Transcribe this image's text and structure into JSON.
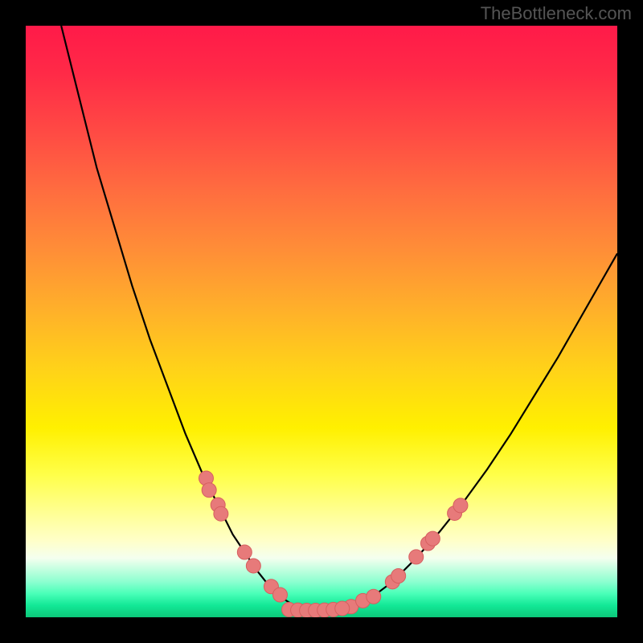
{
  "attribution": "TheBottleneck.com",
  "chart_data": {
    "type": "line",
    "title": "",
    "xlabel": "",
    "ylabel": "",
    "xlim": [
      0,
      100
    ],
    "ylim": [
      0,
      100
    ],
    "curve": {
      "name": "bottleneck-curve",
      "x": [
        6,
        9,
        12,
        15,
        18,
        21,
        24,
        27,
        30,
        33,
        35,
        37,
        39,
        41,
        43,
        45,
        47,
        49,
        51,
        54,
        58,
        62,
        66,
        70,
        74,
        78,
        82,
        86,
        90,
        94,
        98,
        100
      ],
      "y": [
        100,
        88,
        76,
        66,
        56,
        47,
        39,
        31,
        24,
        18,
        14,
        11,
        8,
        5.5,
        3.5,
        2.2,
        1.4,
        1.0,
        1.0,
        1.4,
        3.0,
        6.0,
        10.0,
        14.5,
        19.5,
        25.0,
        31.0,
        37.5,
        44.0,
        51.0,
        58.0,
        61.5
      ]
    },
    "markers": {
      "left_cluster": [
        {
          "x": 30.5,
          "y": 23.5
        },
        {
          "x": 31.0,
          "y": 21.5
        },
        {
          "x": 32.5,
          "y": 19.0
        },
        {
          "x": 33.0,
          "y": 17.5
        },
        {
          "x": 37.0,
          "y": 11.0
        },
        {
          "x": 38.5,
          "y": 8.7
        },
        {
          "x": 41.5,
          "y": 5.2
        },
        {
          "x": 43.0,
          "y": 3.8
        }
      ],
      "right_cluster": [
        {
          "x": 55.0,
          "y": 1.8
        },
        {
          "x": 57.0,
          "y": 2.8
        },
        {
          "x": 58.8,
          "y": 3.5
        },
        {
          "x": 62.0,
          "y": 6.0
        },
        {
          "x": 63.0,
          "y": 7.0
        },
        {
          "x": 66.0,
          "y": 10.2
        },
        {
          "x": 68.0,
          "y": 12.5
        },
        {
          "x": 68.8,
          "y": 13.3
        },
        {
          "x": 72.5,
          "y": 17.6
        },
        {
          "x": 73.5,
          "y": 18.9
        }
      ],
      "bottom_run": [
        {
          "x": 44.5,
          "y": 1.3
        },
        {
          "x": 46.0,
          "y": 1.2
        },
        {
          "x": 47.5,
          "y": 1.15
        },
        {
          "x": 49.0,
          "y": 1.15
        },
        {
          "x": 50.5,
          "y": 1.2
        },
        {
          "x": 52.0,
          "y": 1.3
        },
        {
          "x": 53.5,
          "y": 1.5
        }
      ]
    },
    "colors": {
      "curve": "#000000",
      "marker_fill": "#e77a7a",
      "marker_stroke": "#d65f5f"
    }
  }
}
